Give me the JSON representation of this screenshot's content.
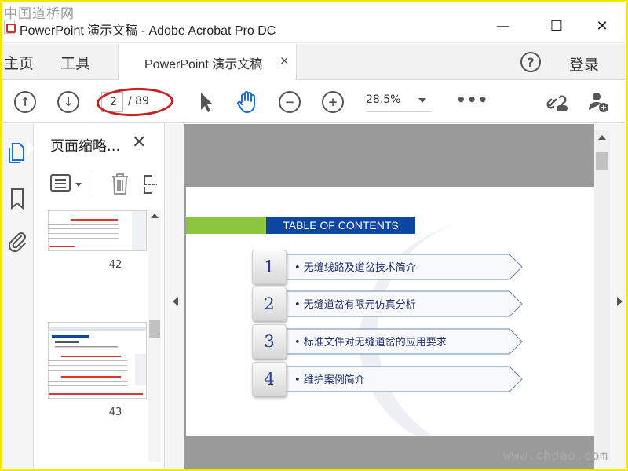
{
  "watermark_top": "中国道桥网",
  "watermark_bottom": "www.chdao.com",
  "window": {
    "title": "PowerPoint 演示文稿 - Adobe Acrobat Pro DC",
    "minimize": "—",
    "maximize": "☐",
    "close": "✕"
  },
  "tabs": {
    "home": "主页",
    "tools": "工具",
    "document": "PowerPoint 演示文稿",
    "document_close": "×",
    "help": "?",
    "login": "登录"
  },
  "toolbar": {
    "prev_page": "↑",
    "next_page": "↓",
    "current_page": "2",
    "total_pages": "/ 89",
    "zoom_out": "−",
    "zoom_in": "+",
    "zoom": "28.5%",
    "more": "•••"
  },
  "thumbnail_panel": {
    "title": "页面缩略...",
    "close": "✕",
    "thumbnails": [
      {
        "page": "42"
      },
      {
        "page": "43"
      }
    ]
  },
  "slide": {
    "heading": "TABLE OF CONTENTS",
    "items": [
      {
        "num": "1",
        "text": "• 无缝线路及道岔技术简介"
      },
      {
        "num": "2",
        "text": "• 无缝道岔有限元仿真分析"
      },
      {
        "num": "3",
        "text": "• 标准文件对无缝道岔的应用要求"
      },
      {
        "num": "4",
        "text": "• 维护案例简介"
      }
    ]
  },
  "colors": {
    "heading_bar": "#0d47a1",
    "accent_green": "#8cc63f",
    "annotation_red": "#c82020",
    "active_blue": "#1a6fd6",
    "border": "#f4e600"
  }
}
